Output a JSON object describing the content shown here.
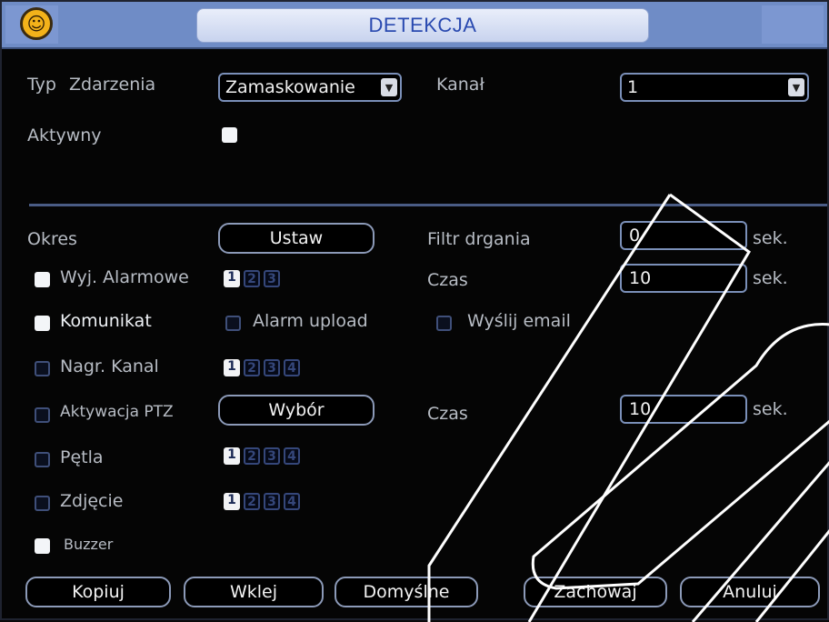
{
  "window": {
    "title": "DETEKCJA"
  },
  "top": {
    "event_type_label": "Typ",
    "event_type_label2": "Zdarzenia",
    "event_type_value": "Zamaskowanie",
    "channel_label": "Kanał",
    "channel_value": "1",
    "active_label": "Aktywny"
  },
  "period": {
    "label": "Okres",
    "button": "Ustaw"
  },
  "debounce": {
    "label": "Filtr drgania",
    "value": "0",
    "unit": "sek."
  },
  "alarm_out": {
    "label": "Wyj. Alarmowe",
    "numbers": [
      "1",
      "2",
      "3"
    ]
  },
  "time1": {
    "label": "Czas",
    "value": "10",
    "unit": "sek."
  },
  "message": {
    "label": "Komunikat"
  },
  "alarm_upload": {
    "label": "Alarm upload"
  },
  "send_email": {
    "label": "Wyślij email"
  },
  "record_channel": {
    "label": "Nagr. Kanal",
    "numbers": [
      "1",
      "2",
      "3",
      "4"
    ]
  },
  "ptz": {
    "label": "Aktywacja PTZ",
    "button": "Wybór"
  },
  "time2": {
    "label": "Czas",
    "value": "10",
    "unit": "sek."
  },
  "loop": {
    "label": "Pętla",
    "numbers": [
      "1",
      "2",
      "3",
      "4"
    ]
  },
  "snapshot": {
    "label": "Zdjęcie",
    "numbers": [
      "1",
      "2",
      "3",
      "4"
    ]
  },
  "buzzer": {
    "label": "Buzzer"
  },
  "footer": {
    "copy": "Kopiuj",
    "paste": "Wklej",
    "defaults": "Domyślne",
    "save": "Zachowaj",
    "cancel": "Anuluj"
  },
  "colors": {
    "titlebar": "#6f8cc6",
    "title_text": "#2a4ab0",
    "panel_bg": "#050505",
    "border_accent": "#7a8fb8"
  }
}
